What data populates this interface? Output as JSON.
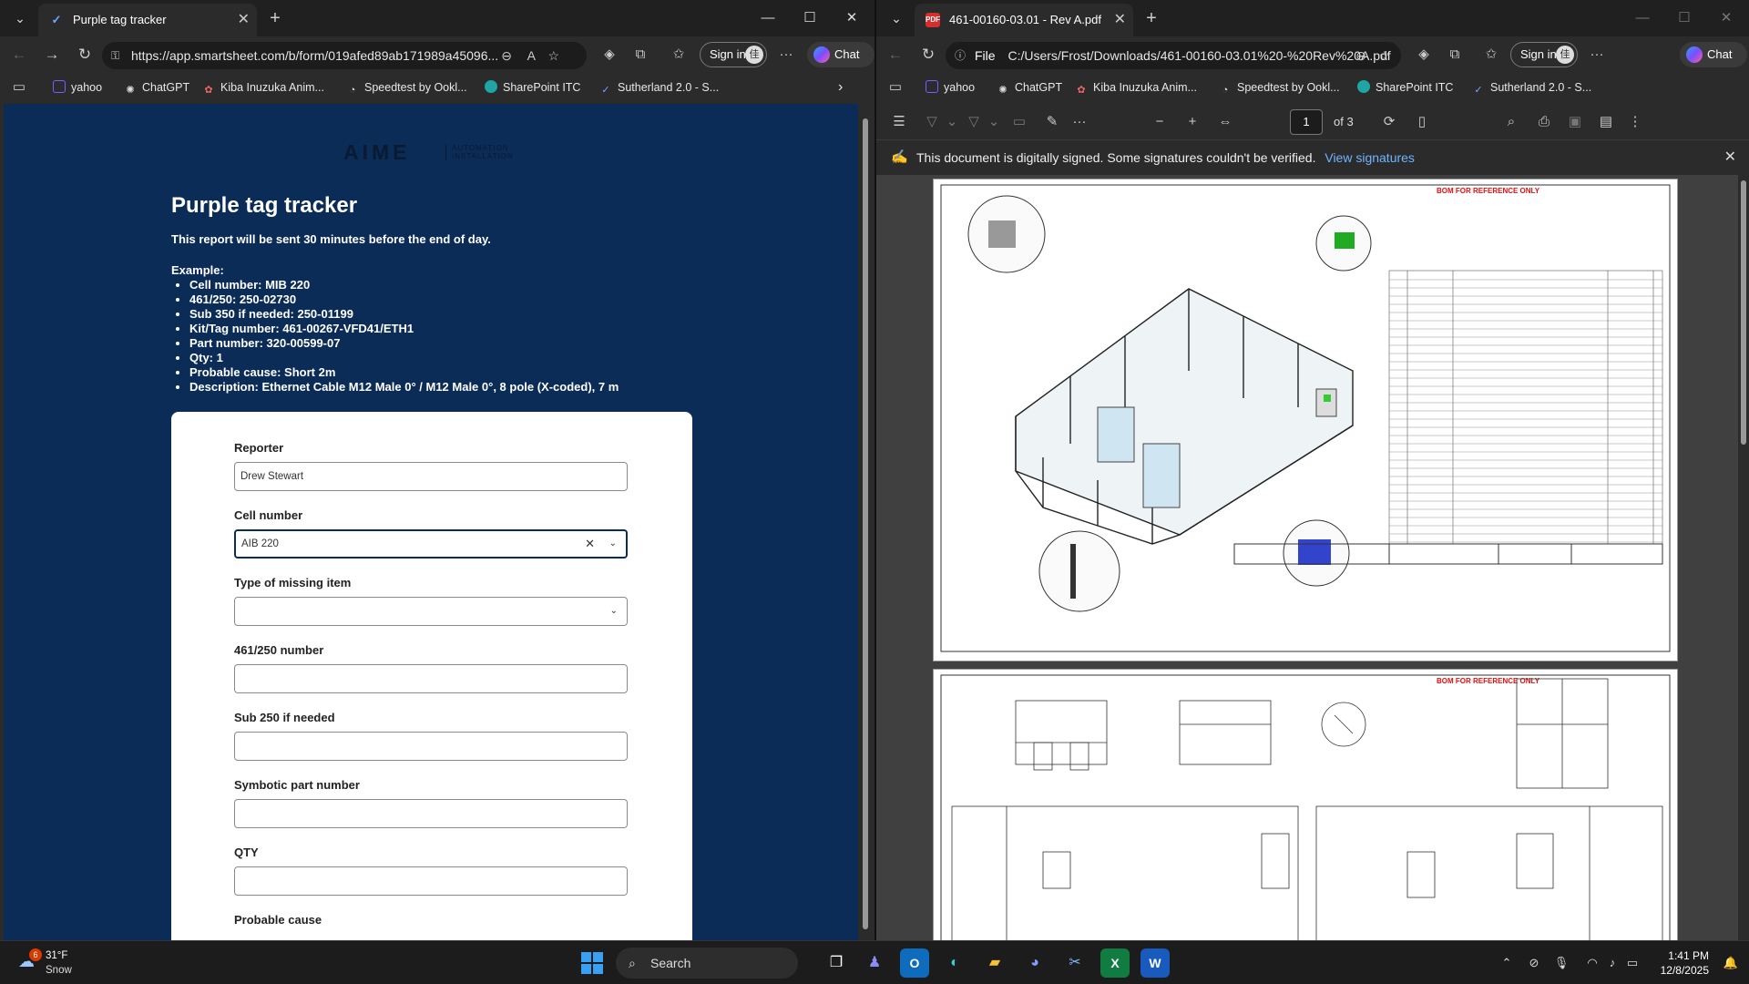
{
  "left_window": {
    "tab_title": "Purple tag tracker",
    "url": "https://app.smartsheet.com/b/form/019afed89ab171989a45096...",
    "signin_label": "Sign in",
    "chat_label": "Chat"
  },
  "right_window": {
    "tab_title": "461-00160-03.01 - Rev A.pdf",
    "url_scheme": "File",
    "url": "C:/Users/Frost/Downloads/461-00160-03.01%20-%20Rev%20A.pdf",
    "signin_label": "Sign in",
    "chat_label": "Chat"
  },
  "bookmarks": [
    {
      "label": "yahoo",
      "icon": "mail-icon",
      "color": "#7b5cff"
    },
    {
      "label": "ChatGPT",
      "icon": "chatgpt-icon",
      "color": "#e0e0e0"
    },
    {
      "label": "Kiba Inuzuka Anim...",
      "icon": "anime-icon",
      "color": "#e66"
    },
    {
      "label": "Speedtest by Ookl...",
      "icon": "speedtest-icon",
      "color": "#e0e0e0"
    },
    {
      "label": "SharePoint ITC",
      "icon": "sharepoint-icon",
      "color": "#1fa5a5"
    },
    {
      "label": "Sutherland 2.0 - S...",
      "icon": "check-icon",
      "color": "#6aa9ff"
    }
  ],
  "form": {
    "logo_text": "AIME",
    "logo_sub": "AUTOMATION INSTALLATION",
    "title": "Purple tag tracker",
    "description": "This report will be sent 30 minutes before the end of day.",
    "example_label": "Example:",
    "examples": [
      "Cell number: MIB 220",
      "461/250: 250-02730",
      "Sub 350 if needed: 250-01199",
      "Kit/Tag number: 461-00267-VFD41/ETH1",
      "Part number: 320-00599-07",
      "Qty: 1",
      "Probable cause: Short 2m",
      "Description: Ethernet Cable M12 Male 0° / M12 Male 0°, 8 pole (X-coded), 7 m"
    ],
    "fields": [
      {
        "label": "Reporter",
        "value": ""
      },
      {
        "label": "Cell number",
        "value": ""
      },
      {
        "label": "Type of missing item",
        "value": ""
      },
      {
        "label": "461/250 number",
        "value": ""
      },
      {
        "label": "Sub 250 if needed",
        "value": ""
      },
      {
        "label": "Symbotic part number",
        "value": ""
      },
      {
        "label": "QTY",
        "value": ""
      },
      {
        "label": "Probable cause",
        "value": ""
      }
    ],
    "reporter_value": "Drew Stewart",
    "cell_value": "AIB 220"
  },
  "pdf": {
    "page_current": "1",
    "page_total": "of 3",
    "signature_message": "This document is digitally signed. Some signatures couldn't be verified.",
    "signature_link": "View signatures",
    "bom_label": "BOM FOR REFERENCE ONLY"
  },
  "taskbar": {
    "weather_temp": "31°F",
    "weather_cond": "Snow",
    "weather_badge": "6",
    "search_label": "Search",
    "time": "1:41 PM",
    "date": "12/8/2025"
  }
}
